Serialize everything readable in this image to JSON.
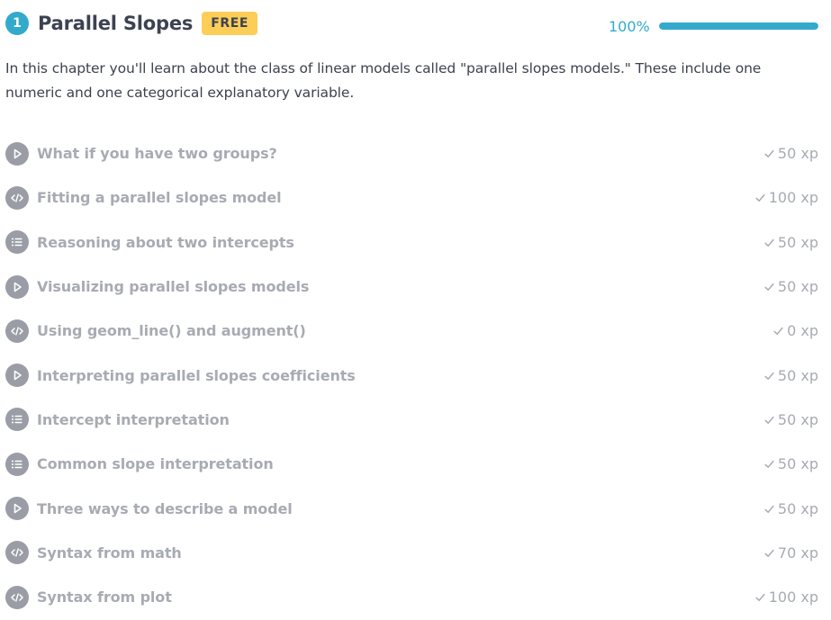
{
  "chapter": {
    "number": "1",
    "title": "Parallel Slopes",
    "badge": "FREE",
    "progress_label": "100%",
    "progress_value": 1.0,
    "description": "In this chapter you'll learn about the class of linear models called \"parallel slopes models.\" These include one numeric and one categorical explanatory variable."
  },
  "colors": {
    "accent": "#33aacc",
    "badge": "#fcce58",
    "heading": "#3d4251",
    "muted_text": "#a8abb3",
    "icon_bg": "#9a9da5"
  },
  "exercises": [
    {
      "title": "What if you have two groups?",
      "xp": "50 xp",
      "icon": "play-icon"
    },
    {
      "title": "Fitting a parallel slopes model",
      "xp": "100 xp",
      "icon": "code-icon"
    },
    {
      "title": "Reasoning about two intercepts",
      "xp": "50 xp",
      "icon": "list-icon"
    },
    {
      "title": "Visualizing parallel slopes models",
      "xp": "50 xp",
      "icon": "play-icon"
    },
    {
      "title": "Using geom_line() and augment()",
      "xp": "0 xp",
      "icon": "code-icon"
    },
    {
      "title": "Interpreting parallel slopes coefficients",
      "xp": "50 xp",
      "icon": "play-icon"
    },
    {
      "title": "Intercept interpretation",
      "xp": "50 xp",
      "icon": "list-icon"
    },
    {
      "title": "Common slope interpretation",
      "xp": "50 xp",
      "icon": "list-icon"
    },
    {
      "title": "Three ways to describe a model",
      "xp": "50 xp",
      "icon": "play-icon"
    },
    {
      "title": "Syntax from math",
      "xp": "70 xp",
      "icon": "code-icon"
    },
    {
      "title": "Syntax from plot",
      "xp": "100 xp",
      "icon": "code-icon"
    }
  ]
}
